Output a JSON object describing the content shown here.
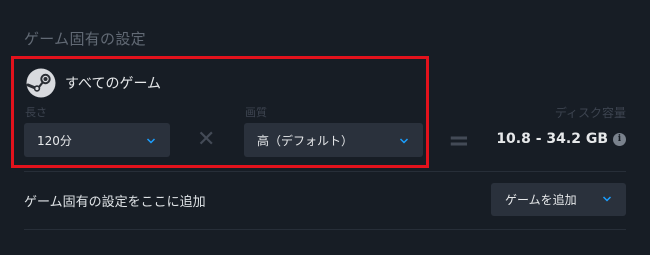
{
  "section_title": "ゲーム固有の設定",
  "game": {
    "name": "すべてのゲーム",
    "icon": "steam-icon"
  },
  "length": {
    "label": "長さ",
    "value": "120分"
  },
  "quality": {
    "label": "画質",
    "value": "高（デフォルト）"
  },
  "operators": {
    "multiply": "✕",
    "equals": "="
  },
  "disk": {
    "label": "ディスク容量",
    "value": "10.8 - 34.2 GB",
    "info_glyph": "i"
  },
  "add_setting": {
    "label": "ゲーム固有の設定をここに追加",
    "button_label": "ゲームを追加"
  },
  "colors": {
    "background": "#171d25",
    "highlight": "#e3121c",
    "dropdown_bg": "#2a313c",
    "chevron": "#1a9fff"
  }
}
